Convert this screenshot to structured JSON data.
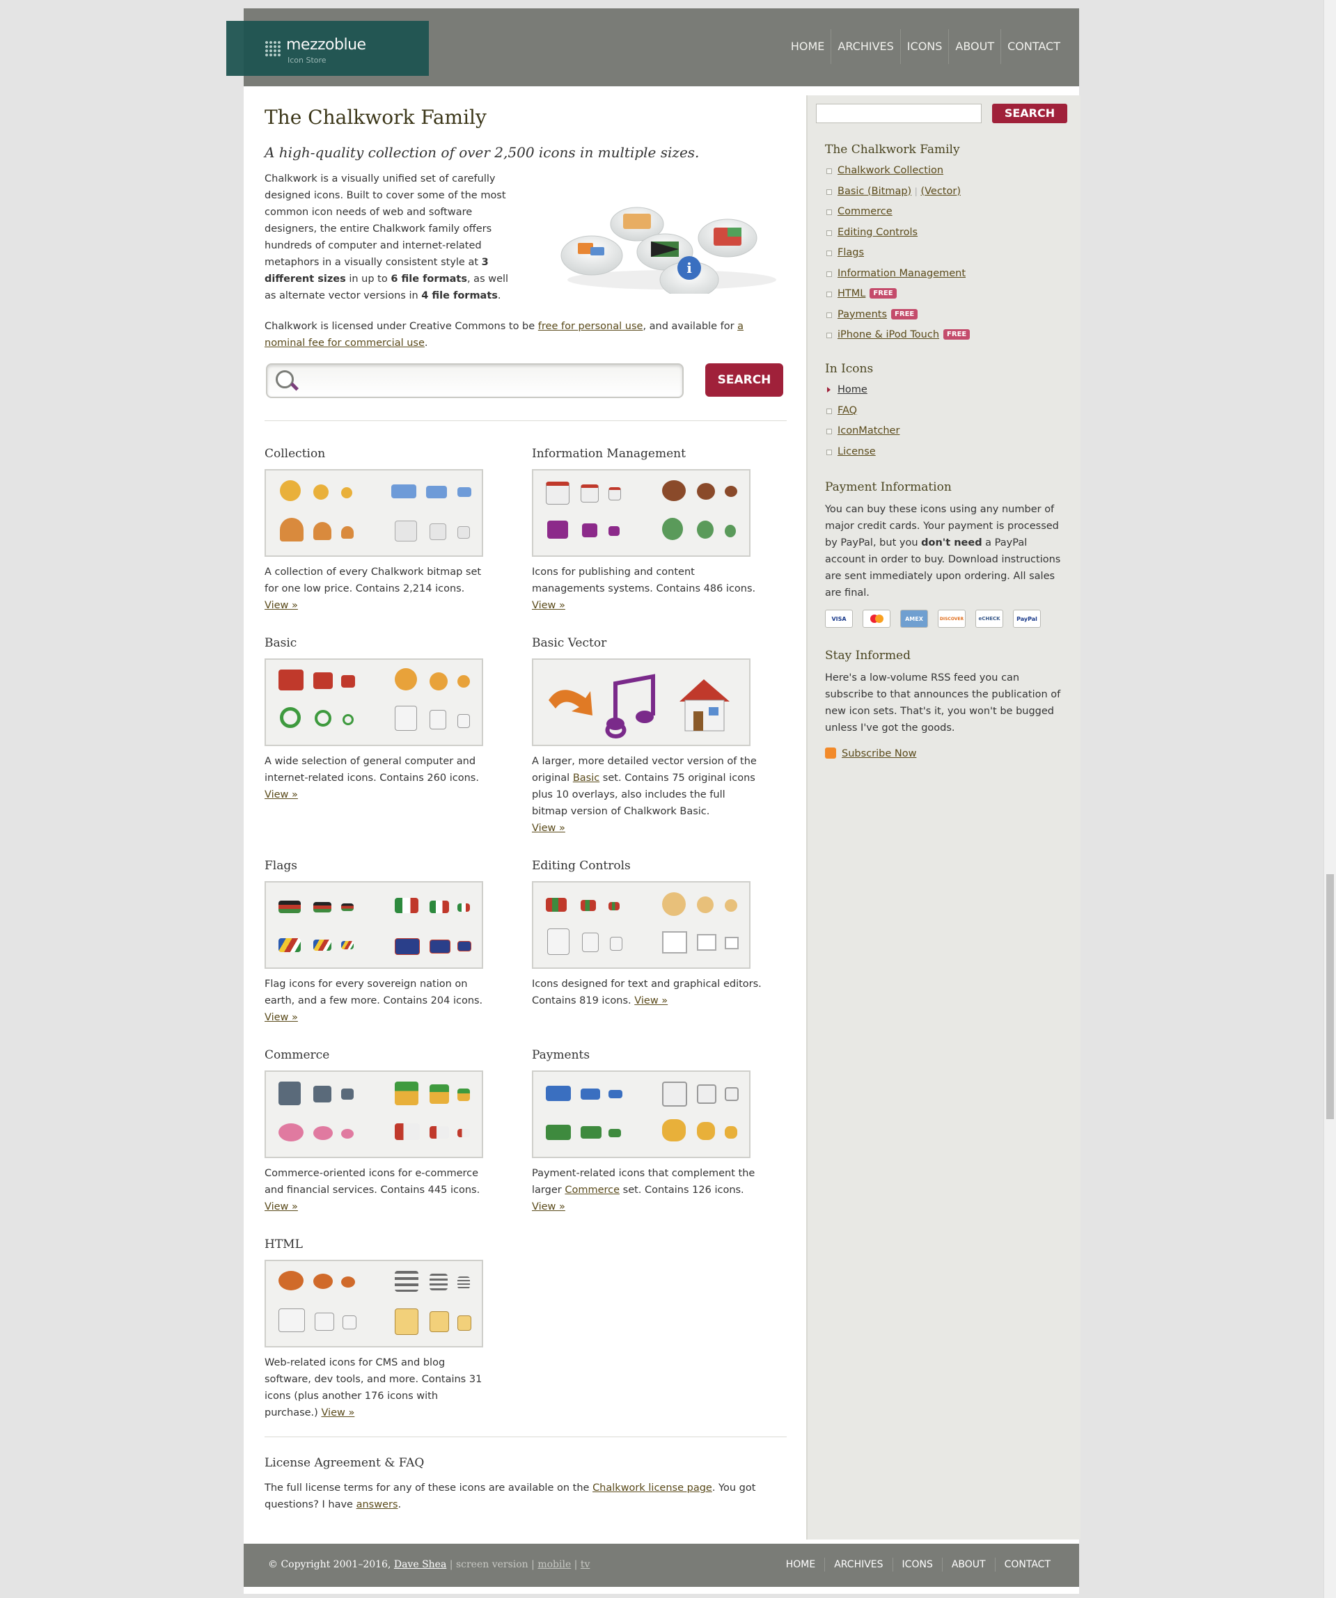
{
  "header": {
    "logo_name": "mezzoblue",
    "logo_sub": "Icon Store",
    "nav": [
      "HOME",
      "ARCHIVES",
      "ICONS",
      "ABOUT",
      "CONTACT"
    ]
  },
  "main": {
    "title": "The Chalkwork Family",
    "tagline": "A high-quality collection of over 2,500 icons in multiple sizes.",
    "intro_a": "Chalkwork is a visually unified set of carefully designed icons. Built to cover some of the most common icon needs of web and software designers, the entire Chalkwork family offers hundreds of computer and internet-related metaphors in a visually consistent style at ",
    "intro_b1": "3 different sizes",
    "intro_c": " in up to ",
    "intro_b2": "6 file formats",
    "intro_d": ", as well as alternate vector versions in ",
    "intro_b3": "4 file formats",
    "intro_e": ".",
    "license_a": "Chalkwork is licensed under Creative Commons to be ",
    "license_link1": "free for personal use",
    "license_b": ", and available for ",
    "license_link2": "a nominal fee for commercial use",
    "license_c": ".",
    "search_button": "SEARCH",
    "view": "View »",
    "items": [
      {
        "title": "Collection",
        "text": "A collection of every Chalkwork bitmap set for one low price. Contains 2,214 icons."
      },
      {
        "title": "Information Management",
        "text": "Icons for publishing and content managements systems. Contains 486 icons."
      },
      {
        "title": "Basic",
        "text": "A wide selection of general computer and internet-related icons. Contains 260 icons."
      },
      {
        "title": "Basic Vector",
        "text_a": "A larger, more detailed vector version of the original ",
        "link": "Basic",
        "text_b": " set. Contains 75 original icons plus 10 overlays, also includes the full bitmap version of Chalkwork Basic."
      },
      {
        "title": "Flags",
        "text": "Flag icons for every sovereign nation on earth, and a few more. Contains 204 icons."
      },
      {
        "title": "Editing Controls",
        "text": "Icons designed for text and graphical editors. Contains 819 icons."
      },
      {
        "title": "Commerce",
        "text": "Commerce-oriented icons for e-commerce and financial services. Contains 445 icons."
      },
      {
        "title": "Payments",
        "text_a": "Payment-related icons that complement the larger ",
        "link": "Commerce",
        "text_b": " set. Contains 126 icons."
      },
      {
        "title": "HTML",
        "text": "Web-related icons for CMS and blog software, dev tools, and more. Contains 31 icons (plus another 176 icons with purchase.)"
      }
    ],
    "license_title": "License Agreement & FAQ",
    "license_text_a": "The full license terms for any of these icons are available on the ",
    "license_text_link": "Chalkwork license page",
    "license_text_b": ". You got questions? I have ",
    "license_text_link2": "answers",
    "license_text_c": "."
  },
  "sidebar": {
    "search_button": "SEARCH",
    "family_title": "The Chalkwork Family",
    "family_links": [
      "Chalkwork Collection",
      "Basic (Bitmap)",
      "(Vector)",
      "Commerce",
      "Editing Controls",
      "Flags",
      "Information Management",
      "HTML",
      "Payments",
      "iPhone & iPod Touch"
    ],
    "free": "FREE",
    "in_icons_title": "In Icons",
    "in_icons": [
      "Home",
      "FAQ",
      "IconMatcher",
      "License"
    ],
    "payment_title": "Payment Information",
    "payment_a": "You can buy these icons using any number of major credit cards. Your payment is processed by PayPal, but you ",
    "payment_bold": "don't need",
    "payment_b": " a PayPal account in order to buy. Download instructions are sent immediately upon ordering. All sales are final.",
    "cards": [
      "VISA",
      "",
      "AMEX",
      "DISCOVER",
      "eCHECK",
      "PayPal"
    ],
    "stay_title": "Stay Informed",
    "stay_text": "Here's a low-volume RSS feed you can subscribe to that announces the publication of new icon sets. That's it, you won't be bugged unless I've got the goods.",
    "subscribe": "Subscribe Now"
  },
  "footer": {
    "copy": "© Copyright 2001–2016, ",
    "author": "Dave Shea",
    "screen": "screen version",
    "mobile": "mobile",
    "tv": "tv",
    "nav": [
      "HOME",
      "ARCHIVES",
      "ICONS",
      "ABOUT",
      "CONTACT"
    ]
  },
  "colors": {
    "accent": "#a0213a",
    "header": "#7a7c77",
    "logo": "#1f5552"
  }
}
